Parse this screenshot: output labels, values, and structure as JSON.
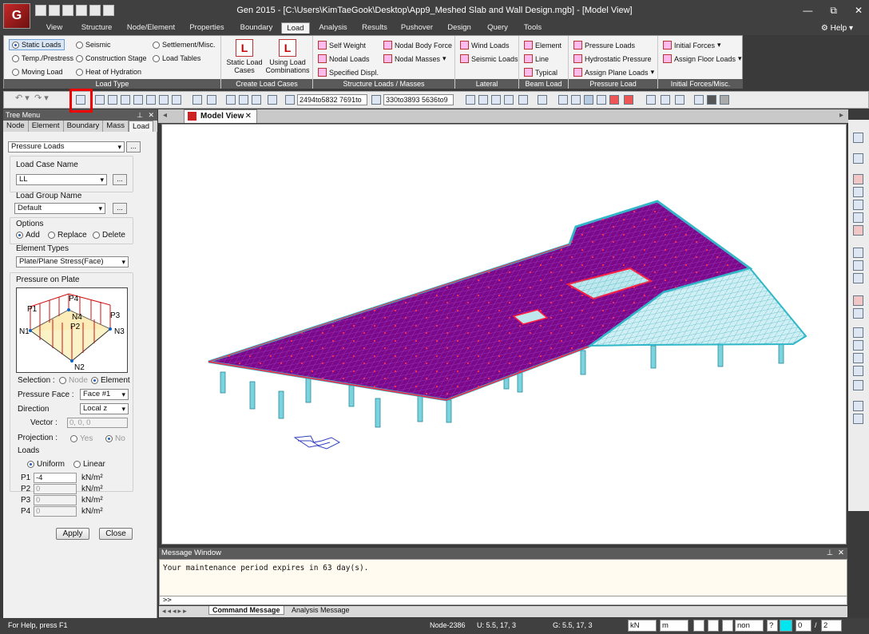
{
  "window": {
    "title": "Gen 2015 - [C:\\Users\\KimTaeGook\\Desktop\\App9_Meshed Slab and Wall Design.mgb] - [Model View]",
    "logo_text": "G",
    "minimize": "—",
    "restore": "⧉",
    "close": "✕"
  },
  "ribbon": {
    "tabs": [
      "View",
      "Structure",
      "Node/Element",
      "Properties",
      "Boundary",
      "Load",
      "Analysis",
      "Results",
      "Pushover",
      "Design",
      "Query",
      "Tools"
    ],
    "active_tab": "Load",
    "help": "Help",
    "groups": {
      "load_type": {
        "caption": "Load Type",
        "items": [
          "Static Loads",
          "Seismic",
          "Settlement/Misc.",
          "Temp./Prestress",
          "Construction Stage",
          "Load Tables",
          "Moving Load",
          "Heat of Hydration"
        ]
      },
      "create_load_cases": {
        "caption": "Create Load Cases",
        "static_line1": "Static Load",
        "static_line2": "Cases",
        "comb_line1": "Using Load",
        "comb_line2": "Combinations"
      },
      "structure_loads": {
        "caption": "Structure Loads / Masses",
        "items": [
          "Self Weight",
          "Nodal Body Force",
          "Nodal Loads",
          "Nodal Masses",
          "Specified Displ."
        ]
      },
      "lateral": {
        "caption": "Lateral",
        "items": [
          "Wind Loads",
          "Seismic Loads"
        ]
      },
      "beam_load": {
        "caption": "Beam Load",
        "items": [
          "Element",
          "Line",
          "Typical"
        ]
      },
      "pressure_load": {
        "caption": "Pressure Load",
        "items": [
          "Pressure Loads",
          "Hydrostatic Pressure",
          "Assign Plane Loads"
        ]
      },
      "initial_forces": {
        "caption": "Initial Forces/Misc.",
        "items": [
          "Initial Forces",
          "Assign Floor Loads"
        ]
      }
    }
  },
  "toolbar": {
    "combo1": "2494to5832 7691to",
    "combo2": "330to3893 5636to9"
  },
  "tree_menu": {
    "title": "Tree Menu",
    "pin": "⊥",
    "close": "✕",
    "tabs": [
      "Node",
      "Element",
      "Boundary",
      "Mass",
      "Load"
    ],
    "active_tab": "Load",
    "load_kind": "Pressure Loads",
    "load_case_label": "Load Case Name",
    "load_case_value": "LL",
    "load_group_label": "Load Group Name",
    "load_group_value": "Default",
    "options_label": "Options",
    "options": [
      "Add",
      "Replace",
      "Delete"
    ],
    "element_types_label": "Element Types",
    "element_types_value": "Plate/Plane Stress(Face)",
    "pressure_on_plate_label": "Pressure on Plate",
    "diagram_labels": {
      "p1": "P1",
      "p2": "P2",
      "p3": "P3",
      "p4": "P4",
      "n1": "N1",
      "n2": "N2",
      "n3": "N3",
      "n4": "N4"
    },
    "selection_label": "Selection :",
    "selection_options": [
      "Node",
      "Element"
    ],
    "pressure_face_label": "Pressure Face :",
    "pressure_face_value": "Face #1",
    "direction_label": "Direction",
    "direction_value": "Local z",
    "vector_label": "Vector :",
    "vector_value": "0, 0, 0",
    "projection_label": "Projection :",
    "projection_options": [
      "Yes",
      "No"
    ],
    "loads_label": "Loads",
    "loads_options": [
      "Uniform",
      "Linear"
    ],
    "pressures": [
      {
        "label": "P1",
        "value": "-4",
        "unit": "kN/m²"
      },
      {
        "label": "P2",
        "value": "0",
        "unit": "kN/m²"
      },
      {
        "label": "P3",
        "value": "0",
        "unit": "kN/m²"
      },
      {
        "label": "P4",
        "value": "0",
        "unit": "kN/m²"
      }
    ],
    "apply": "Apply",
    "close_btn": "Close"
  },
  "model_view": {
    "tab_label": "Model View",
    "close": "✕"
  },
  "message_window": {
    "title": "Message Window",
    "message": "Your maintenance period expires in 63 day(s).",
    "prompt": ">>",
    "tabs": [
      "Command Message",
      "Analysis Message"
    ]
  },
  "status_bar": {
    "help": "For Help, press F1",
    "node": "Node-2386",
    "u": "U: 5.5, 17, 3",
    "g": "G: 5.5, 17, 3",
    "force_unit": "kN",
    "length_unit": "m",
    "filter": "non",
    "help_icon": "?",
    "page_current": "0",
    "page_sep": "/",
    "page_total": "2"
  },
  "colors": {
    "slab": "#7a0a8a",
    "mesh_edge": "#30b8c8",
    "light_mesh": "#cfeff4",
    "load_marks": "#ff2040",
    "chrome": "#404040"
  }
}
